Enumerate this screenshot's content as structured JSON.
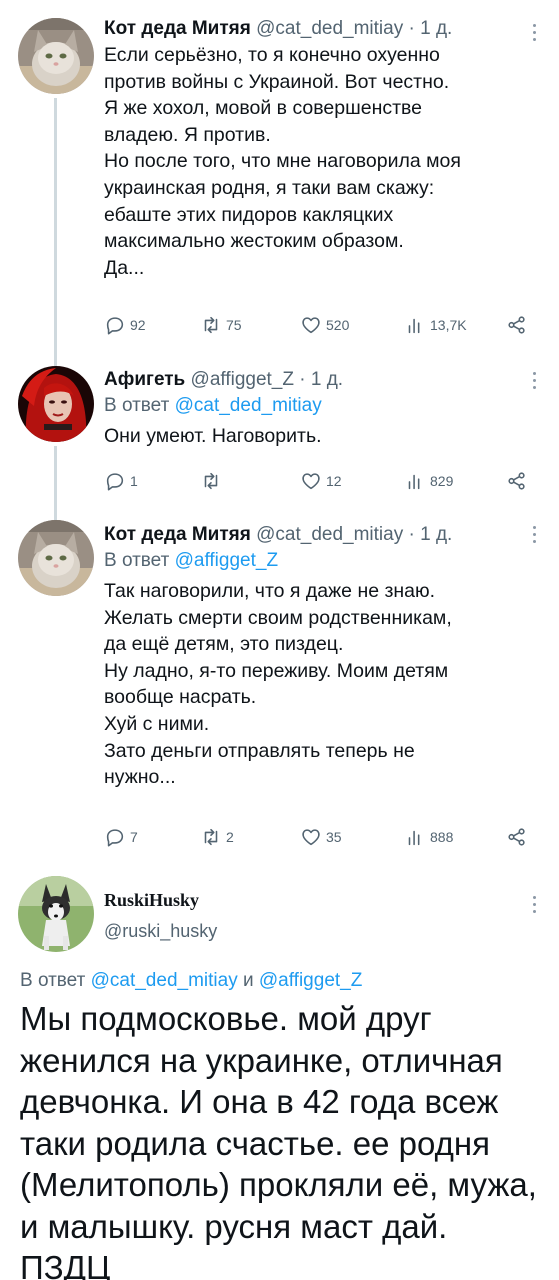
{
  "tweets": [
    {
      "name": "Кот деда Митяя",
      "handle": "@cat_ded_mitiay",
      "time": "· 1 д.",
      "text": "Если серьёзно, то я конечно охуенно\nпротив войны с Украиной. Вот честно.\nЯ же хохол, мовой в совершенстве\nвладею. Я против.\nНо после того, что мне наговорила моя\nукраинская родня, я таки вам скажу:\nебаште этих пидоров какляцких\nмаксимально жестоким образом.\nДа...",
      "stats": {
        "replies": "92",
        "retweets": "75",
        "likes": "520",
        "views": "13,7K"
      }
    },
    {
      "name": "Афигеть",
      "handle": "@affigget_Z",
      "time": "· 1 д.",
      "reply_prefix": "В ответ",
      "reply_to": "@cat_ded_mitiay",
      "text": "Они умеют. Наговорить.",
      "stats": {
        "replies": "1",
        "retweets": "",
        "likes": "12",
        "views": "829"
      }
    },
    {
      "name": "Кот деда Митяя",
      "handle": "@cat_ded_mitiay",
      "time": "· 1 д.",
      "reply_prefix": "В ответ",
      "reply_to": "@affigget_Z",
      "text": "Так наговорили, что я даже не знаю.\nЖелать смерти своим родственникам,\nда ещё детям, это пиздец.\nНу ладно, я-то переживу. Моим детям\nвообще насрать.\nХуй с ними.\nЗато деньги отправлять теперь не\nнужно...",
      "stats": {
        "replies": "7",
        "retweets": "2",
        "likes": "35",
        "views": "888"
      }
    }
  ],
  "main_tweet": {
    "name": "RuskiHusky",
    "handle": "@ruski_husky",
    "reply_prefix": "В ответ",
    "reply_to_1": "@cat_ded_mitiay",
    "reply_join": "и",
    "reply_to_2": "@affigget_Z",
    "text": "Мы подмосковье. мой друг\nженился на украинке, отличная\nдевчонка. И она в 42 года всеж\nтаки родила счастье. ее родня\n(Мелитополь) прокляли её, мужа,\nи малышку. русня маст дай.\nПЗДЦ"
  },
  "colors": {
    "accent": "#1d9bf0",
    "secondary_text": "#536471",
    "thread_line": "#cfd9de"
  },
  "icons": [
    "reply-icon",
    "retweet-icon",
    "like-icon",
    "views-icon",
    "share-icon",
    "more-icon"
  ]
}
